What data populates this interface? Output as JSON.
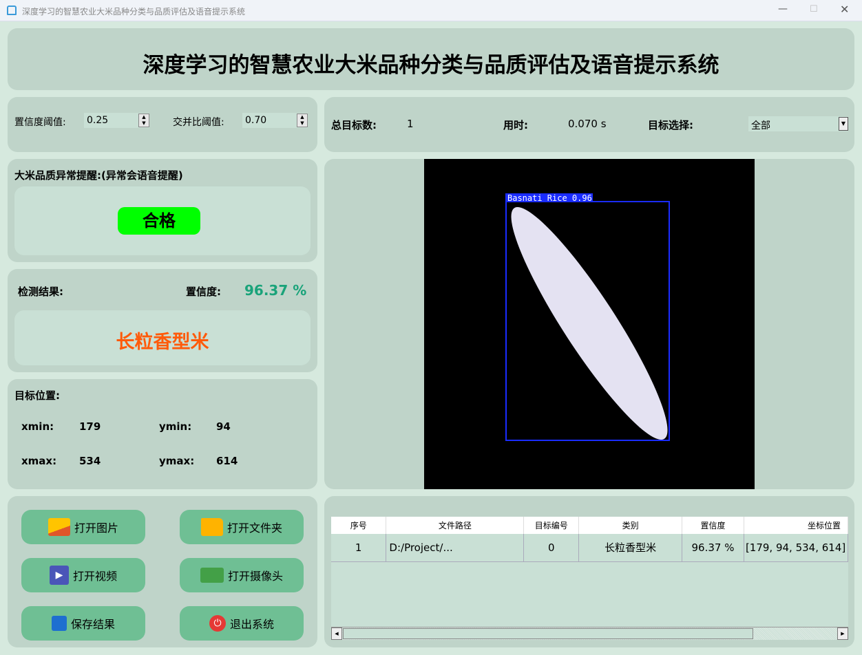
{
  "window": {
    "title": "深度学习的智慧农业大米品种分类与品质评估及语音提示系统"
  },
  "header": {
    "title": "深度学习的智慧农业大米品种分类与品质评估及语音提示系统"
  },
  "params": {
    "conf_label": "置信度阈值:",
    "conf_value": "0.25",
    "iou_label": "交并比阈值:",
    "iou_value": "0.70"
  },
  "stats": {
    "total_label": "总目标数:",
    "total_value": "1",
    "time_label": "用时:",
    "time_value": "0.070 s",
    "select_label": "目标选择:",
    "select_value": "全部"
  },
  "alert": {
    "label": "大米品质异常提醒:(异常会语音提醒)",
    "status": "合格",
    "status_color": "#00ff00"
  },
  "result": {
    "label": "检测结果:",
    "conf_label": "置信度:",
    "conf_value": "96.37 %",
    "class": "长粒香型米"
  },
  "position": {
    "label": "目标位置:",
    "xmin_label": "xmin:",
    "xmin": "179",
    "ymin_label": "ymin:",
    "ymin": "94",
    "xmax_label": "xmax:",
    "xmax": "534",
    "ymax_label": "ymax:",
    "ymax": "614"
  },
  "buttons": {
    "open_image": "打开图片",
    "open_folder": "打开文件夹",
    "open_video": "打开视频",
    "open_camera": "打开摄像头",
    "save": "保存结果",
    "exit": "退出系统"
  },
  "detection": {
    "box_label": "Basnati Rice 0.96"
  },
  "table": {
    "headers": [
      "序号",
      "文件路径",
      "目标编号",
      "类别",
      "置信度",
      "坐标位置"
    ],
    "rows": [
      [
        "1",
        "D:/Project/...",
        "0",
        "长粒香型米",
        "96.37 %",
        "[179, 94, 534, 614]"
      ]
    ]
  }
}
